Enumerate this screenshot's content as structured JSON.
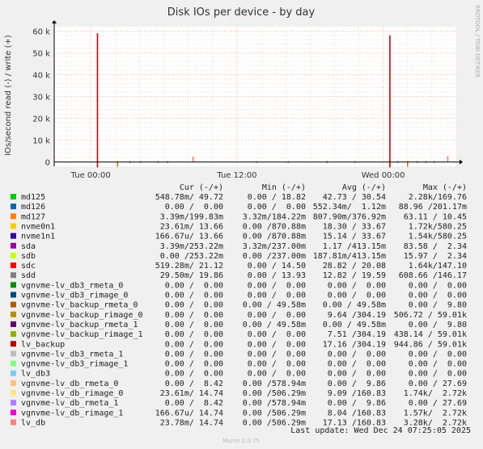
{
  "chart_data": {
    "type": "line",
    "title": "Disk IOs per device - by day",
    "ylabel": "IOs/second read (-) / write (+)",
    "side_label": "RRDTOOL / TOBI OETIKER",
    "footer": "Munin 2.0.75",
    "last_update": "Last update: Wed Dec 24 07:25:05 2025",
    "y_ticks": [
      {
        "value": 0,
        "label": "0"
      },
      {
        "value": 10000,
        "label": "10 k"
      },
      {
        "value": 20000,
        "label": "20 k"
      },
      {
        "value": 30000,
        "label": "30 k"
      },
      {
        "value": 40000,
        "label": "40 k"
      },
      {
        "value": 50000,
        "label": "50 k"
      },
      {
        "value": 60000,
        "label": "60 k"
      }
    ],
    "ylim": [
      -2000,
      62000
    ],
    "xlim_hours": [
      -3,
      30
    ],
    "x_ticks": [
      {
        "hour": 0,
        "label": "Tue 00:00"
      },
      {
        "hour": 12,
        "label": "Tue 12:00"
      },
      {
        "hour": 24,
        "label": "Wed 00:00"
      }
    ],
    "grid": true,
    "spikes": [
      {
        "hour": 0.55,
        "up": 59000,
        "down": 2500,
        "color": "#cc0000"
      },
      {
        "hour": 24.55,
        "up": 58000,
        "down": 2500,
        "color": "#cc0000"
      },
      {
        "hour": 8.4,
        "up": 2500,
        "down": 0,
        "color": "#ff7777"
      },
      {
        "hour": 29.3,
        "up": 2700,
        "down": 0,
        "color": "#ff7777"
      },
      {
        "hour": 2.2,
        "up": 400,
        "down": 2200,
        "color": "#aa8800"
      },
      {
        "hour": 26.0,
        "up": 400,
        "down": 2200,
        "color": "#aa8800"
      }
    ],
    "legend_header": {
      "cur": "Cur (-/+)",
      "min": "Min (-/+)",
      "avg": "Avg (-/+)",
      "max": "Max (-/+)"
    },
    "series": [
      {
        "name": "md125",
        "color": "#00cc00",
        "cur": "548.78m/ 49.72",
        "min": "0.00 / 18.82",
        "avg": "42.73 / 30.54",
        "max": "2.28k/169.76"
      },
      {
        "name": "md126",
        "color": "#0066b3",
        "cur": "0.00 /  0.00",
        "min": "0.00 /  0.00",
        "avg": "552.34m/  1.12m",
        "max": "88.96 /201.17m"
      },
      {
        "name": "md127",
        "color": "#ff8000",
        "cur": "3.39m/199.83m",
        "min": "3.32m/184.22m",
        "avg": "807.90m/376.92m",
        "max": "63.11 / 10.45"
      },
      {
        "name": "nvme0n1",
        "color": "#ffcc00",
        "cur": "23.61m/ 13.66",
        "min": "0.00 /870.88m",
        "avg": "18.30 / 33.67",
        "max": "1.72k/580.25"
      },
      {
        "name": "nvme1n1",
        "color": "#330099",
        "cur": "166.67u/ 13.66",
        "min": "0.00 /870.88m",
        "avg": "15.14 / 33.67",
        "max": "1.54k/580.25"
      },
      {
        "name": "sda",
        "color": "#990099",
        "cur": "3.39m/253.22m",
        "min": "3.32m/237.00m",
        "avg": "1.17 /413.15m",
        "max": "83.58 /  2.34"
      },
      {
        "name": "sdb",
        "color": "#ccff00",
        "cur": "0.00 /253.22m",
        "min": "0.00 /237.00m",
        "avg": "187.81m/413.15m",
        "max": "15.97 /  2.34"
      },
      {
        "name": "sdc",
        "color": "#ff0000",
        "cur": "519.28m/ 21.12",
        "min": "0.00 / 14.50",
        "avg": "28.82 / 20.08",
        "max": "1.64k/147.10"
      },
      {
        "name": "sdd",
        "color": "#808080",
        "cur": "29.50m/ 19.86",
        "min": "0.00 / 13.93",
        "avg": "12.82 / 19.59",
        "max": "608.66 /146.17"
      },
      {
        "name": "vgnvme-lv_db3_rmeta_0",
        "color": "#008f00",
        "cur": "0.00 /  0.00",
        "min": "0.00 /  0.00",
        "avg": "0.00 /  0.00",
        "max": "0.00 /  0.00"
      },
      {
        "name": "vgnvme-lv_db3_rimage_0",
        "color": "#00487d",
        "cur": "0.00 /  0.00",
        "min": "0.00 /  0.00",
        "avg": "0.00 /  0.00",
        "max": "0.00 /  0.00"
      },
      {
        "name": "vgnvme-lv_backup_rmeta_0",
        "color": "#b35a00",
        "cur": "0.00 /  0.00",
        "min": "0.00 / 49.58m",
        "avg": "0.00 / 49.58m",
        "max": "0.00 /  9.80"
      },
      {
        "name": "vgnvme-lv_backup_rimage_0",
        "color": "#b38f00",
        "cur": "0.00 /  0.00",
        "min": "0.00 /  0.00",
        "avg": "9.64 /304.19",
        "max": "506.72 / 59.01k"
      },
      {
        "name": "vgnvme-lv_backup_rmeta_1",
        "color": "#6b006b",
        "cur": "0.00 /  0.00",
        "min": "0.00 / 49.58m",
        "avg": "0.00 / 49.58m",
        "max": "0.00 /  9.80"
      },
      {
        "name": "vgnvme-lv_backup_rimage_1",
        "color": "#8fb300",
        "cur": "0.00 /  0.00",
        "min": "0.00 /  0.00",
        "avg": "7.51 /304.19",
        "max": "438.14 / 59.01k"
      },
      {
        "name": "lv_backup",
        "color": "#b30000",
        "cur": "0.00 /  0.00",
        "min": "0.00 /  0.00",
        "avg": "17.16 /304.19",
        "max": "944.86 / 59.01k"
      },
      {
        "name": "vgnvme-lv_db3_rmeta_1",
        "color": "#bebebe",
        "cur": "0.00 /  0.00",
        "min": "0.00 /  0.00",
        "avg": "0.00 /  0.00",
        "max": "0.00 /  0.00"
      },
      {
        "name": "vgnvme-lv_db3_rimage_1",
        "color": "#80ff80",
        "cur": "0.00 /  0.00",
        "min": "0.00 /  0.00",
        "avg": "0.00 /  0.00",
        "max": "0.00 /  0.00"
      },
      {
        "name": "lv_db3",
        "color": "#80c9ff",
        "cur": "0.00 /  0.00",
        "min": "0.00 /  0.00",
        "avg": "0.00 /  0.00",
        "max": "0.00 /  0.00"
      },
      {
        "name": "vgnvme-lv_db_rmeta_0",
        "color": "#ffc080",
        "cur": "0.00 /  8.42",
        "min": "0.00 /578.94m",
        "avg": "0.00 /  9.86",
        "max": "0.00 / 27.69"
      },
      {
        "name": "vgnvme-lv_db_rimage_0",
        "color": "#ffe680",
        "cur": "23.61m/ 14.74",
        "min": "0.00 /506.29m",
        "avg": "9.09 /160.83",
        "max": "1.74k/  2.72k"
      },
      {
        "name": "vgnvme-lv_db_rmeta_1",
        "color": "#aa80ff",
        "cur": "0.00 /  8.42",
        "min": "0.00 /578.94m",
        "avg": "0.00 /  9.86",
        "max": "0.00 / 27.69"
      },
      {
        "name": "vgnvme-lv_db_rimage_1",
        "color": "#ee00cc",
        "cur": "166.67u/ 14.74",
        "min": "0.00 /506.29m",
        "avg": "8.04 /160.83",
        "max": "1.57k/  2.72k"
      },
      {
        "name": "lv_db",
        "color": "#ff8080",
        "cur": "23.78m/ 14.74",
        "min": "0.00 /506.29m",
        "avg": "17.13 /160.83",
        "max": "3.28k/  2.72k"
      }
    ]
  }
}
